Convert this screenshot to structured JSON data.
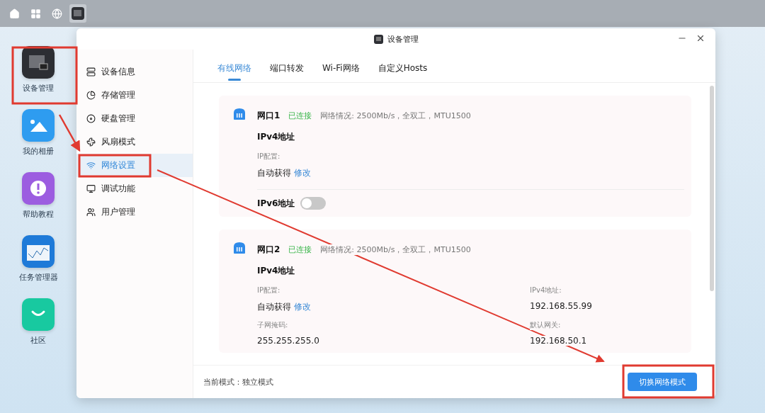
{
  "taskbar": {
    "items": [
      {
        "kind": "home",
        "selected": false
      },
      {
        "kind": "apps",
        "selected": false
      },
      {
        "kind": "globe",
        "selected": false
      },
      {
        "kind": "device",
        "selected": true
      }
    ]
  },
  "desktop_icons": [
    {
      "label": "设备管理",
      "kind": "device"
    },
    {
      "label": "我的相册",
      "kind": "photos"
    },
    {
      "label": "帮助教程",
      "kind": "help"
    },
    {
      "label": "任务管理器",
      "kind": "monitor"
    },
    {
      "label": "社区",
      "kind": "community"
    }
  ],
  "window": {
    "title": "设备管理"
  },
  "sidebar": {
    "items": [
      {
        "label": "设备信息",
        "kind": "info",
        "selected": false
      },
      {
        "label": "存储管理",
        "kind": "storage",
        "selected": false
      },
      {
        "label": "硬盘管理",
        "kind": "disk",
        "selected": false
      },
      {
        "label": "风扇模式",
        "kind": "fan",
        "selected": false
      },
      {
        "label": "网络设置",
        "kind": "network",
        "selected": true
      },
      {
        "label": "调试功能",
        "kind": "debug",
        "selected": false
      },
      {
        "label": "用户管理",
        "kind": "users",
        "selected": false
      }
    ]
  },
  "tabs": [
    {
      "label": "有线网络",
      "selected": true
    },
    {
      "label": "端口转发",
      "selected": false
    },
    {
      "label": "Wi-Fi网络",
      "selected": false
    },
    {
      "label": "自定义Hosts",
      "selected": false
    }
  ],
  "ports": [
    {
      "name": "网口1",
      "status": "已连接",
      "details": "网络情况: 2500Mb/s，全双工，MTU1500",
      "ipv4_title": "IPv4地址",
      "fields": [
        {
          "label": "IP配置:",
          "value": "自动获得",
          "link": "修改"
        }
      ],
      "ipv6": {
        "label": "IPv6地址",
        "on": false
      }
    },
    {
      "name": "网口2",
      "status": "已连接",
      "details": "网络情况: 2500Mb/s，全双工，MTU1500",
      "ipv4_title": "IPv4地址",
      "fields": [
        {
          "label": "IP配置:",
          "value": "自动获得",
          "link": "修改"
        },
        {
          "label": "IPv4地址:",
          "value": "192.168.55.99"
        },
        {
          "label": "子网掩码:",
          "value": "255.255.255.0"
        },
        {
          "label": "默认网关:",
          "value": "192.168.50.1"
        }
      ]
    }
  ],
  "footer": {
    "mode": "当前模式：独立模式",
    "button": "切换网络模式"
  }
}
